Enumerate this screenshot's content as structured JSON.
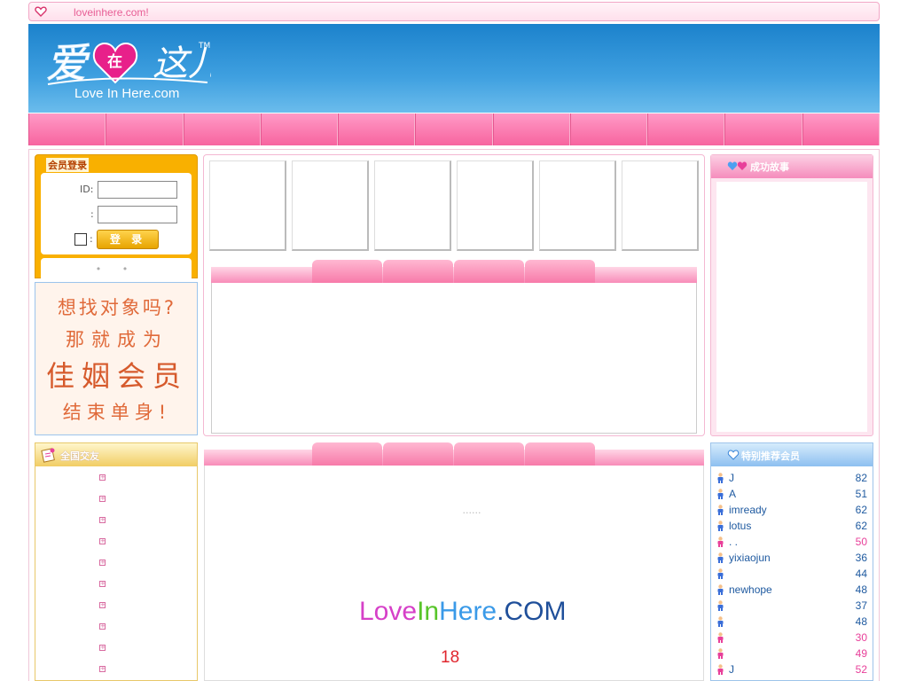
{
  "topbar": {
    "url_text": "loveinhere.com!"
  },
  "banner": {
    "logo_main": "爱在这儿",
    "logo_heart_char": "在",
    "logo_sub": "Love In Here.com",
    "logo_tm": "TM"
  },
  "login": {
    "title": "会员登录",
    "id_label": "ID:",
    "pwd_label": ":",
    "remember_label": ":",
    "button_label": "登 录",
    "dots": "• •"
  },
  "ad": {
    "line1": "想找对象吗?",
    "line2": "那就成为",
    "line3": "佳姻会员",
    "line4": "结束单身!"
  },
  "story": {
    "title": "成功故事"
  },
  "friends": {
    "title": "全国交友"
  },
  "center_bottom": {
    "dots": "......",
    "brand_a": "Love",
    "brand_b": "In",
    "brand_c": "Here",
    "brand_d": ".COM",
    "age_note": "18"
  },
  "recommend": {
    "title": "特别推荐会员",
    "members": [
      {
        "name": "J",
        "age": "82",
        "gender": "male"
      },
      {
        "name": "A",
        "age": "51",
        "gender": "male"
      },
      {
        "name": "imready",
        "age": "62",
        "gender": "male"
      },
      {
        "name": "lotus",
        "age": "62",
        "gender": "male"
      },
      {
        "name": ". .",
        "age": "50",
        "gender": "female"
      },
      {
        "name": "yixiaojun",
        "age": "36",
        "gender": "male"
      },
      {
        "name": "",
        "age": "44",
        "gender": "male"
      },
      {
        "name": "newhope",
        "age": "48",
        "gender": "male"
      },
      {
        "name": "",
        "age": "37",
        "gender": "male"
      },
      {
        "name": "",
        "age": "48",
        "gender": "male"
      },
      {
        "name": "",
        "age": "30",
        "gender": "female"
      },
      {
        "name": "",
        "age": "49",
        "gender": "female"
      },
      {
        "name": "J",
        "age": "52",
        "gender": "female"
      }
    ]
  },
  "colors": {
    "male_age": "#1f5aa0",
    "female_age": "#e8409a",
    "brand_pink": "#f7649f",
    "banner_blue": "#1c82cc"
  },
  "icons": {
    "topbar": "heart-icon",
    "story": "hearts-icon",
    "friends": "note-icon",
    "recommend": "heart-icon",
    "member_male": "person-male-icon",
    "member_female": "person-female-icon"
  }
}
